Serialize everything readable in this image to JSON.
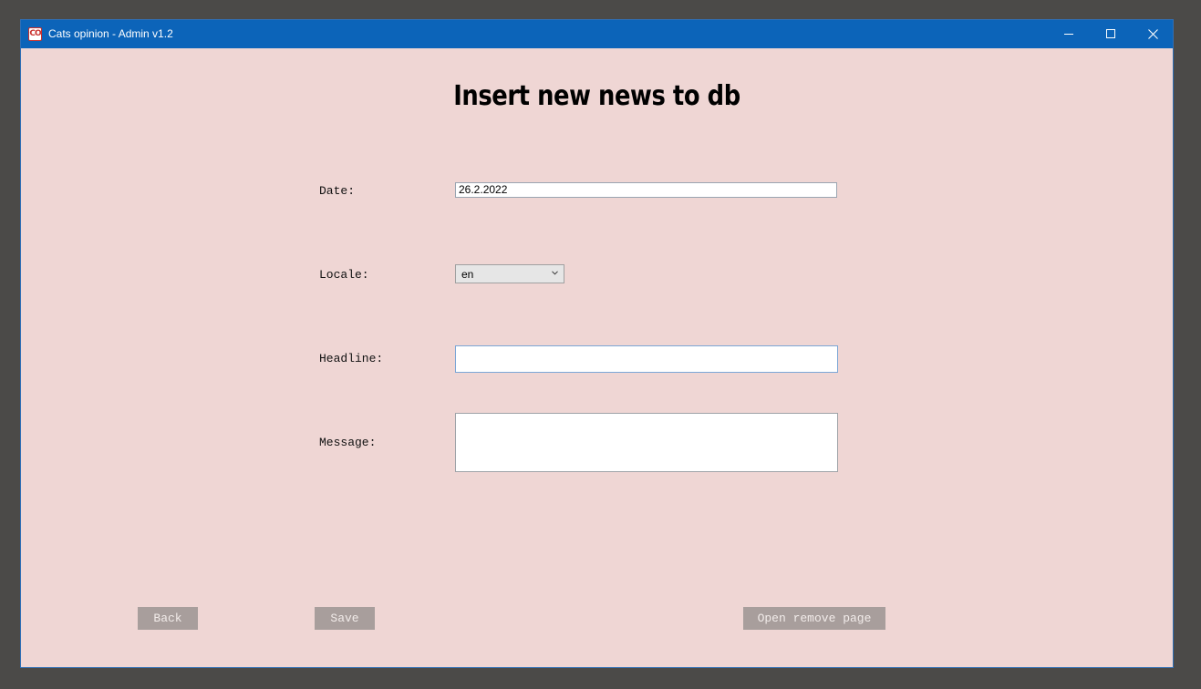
{
  "window": {
    "title": "Cats opinion - Admin v1.2",
    "icon_text": "CO"
  },
  "page": {
    "title": "Insert new news to db"
  },
  "form": {
    "date_label": "Date:",
    "date_value": "26.2.2022",
    "locale_label": "Locale:",
    "locale_value": "en",
    "headline_label": "Headline:",
    "headline_value": "",
    "message_label": "Message:",
    "message_value": ""
  },
  "actions": {
    "back_label": "Back",
    "save_label": "Save",
    "remove_label": "Open remove page"
  },
  "colors": {
    "titlebar": "#0c64b9",
    "background": "#efd6d4",
    "button": "#a89e9c"
  }
}
